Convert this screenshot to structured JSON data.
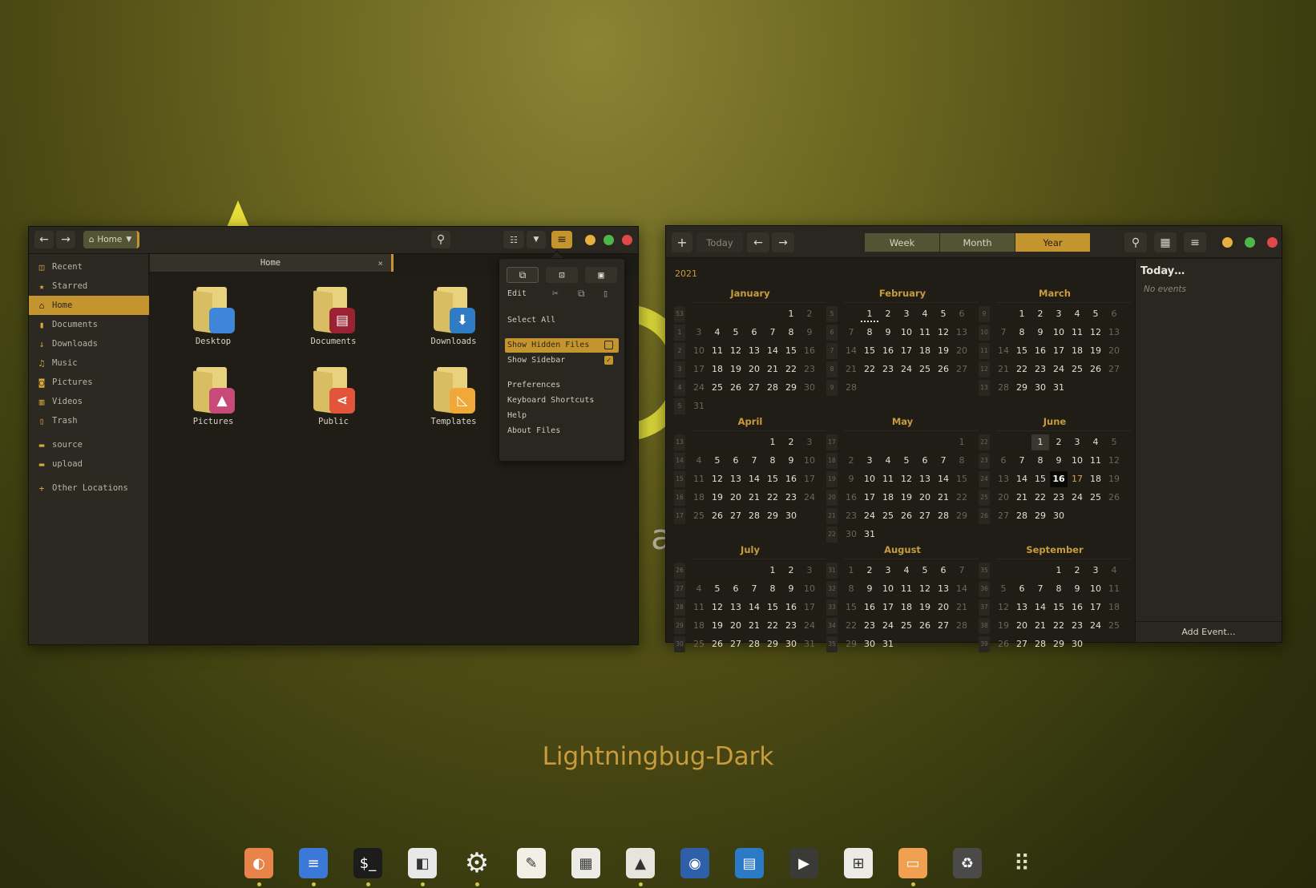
{
  "wallpaper": {
    "caption": "Lightningbug-Dark",
    "partial_letter": "a"
  },
  "files": {
    "path_button": "Home",
    "tab": {
      "label": "Home",
      "close": "×"
    },
    "sidebar": [
      {
        "label": "Recent",
        "icon": "recent-icon",
        "glyph": "◫"
      },
      {
        "label": "Starred",
        "icon": "star-icon",
        "glyph": "★"
      },
      {
        "label": "Home",
        "icon": "home-icon",
        "glyph": "⌂",
        "active": true
      },
      {
        "label": "Documents",
        "icon": "document-icon",
        "glyph": "▮"
      },
      {
        "label": "Downloads",
        "icon": "download-icon",
        "glyph": "↓"
      },
      {
        "label": "Music",
        "icon": "music-icon",
        "glyph": "♫"
      },
      {
        "label": "Pictures",
        "icon": "camera-icon",
        "glyph": "◙"
      },
      {
        "label": "Videos",
        "icon": "film-icon",
        "glyph": "▥"
      },
      {
        "label": "Trash",
        "icon": "trash-icon",
        "glyph": "▯"
      },
      {
        "label": "source",
        "icon": "folder-icon",
        "glyph": "▬"
      },
      {
        "label": "upload",
        "icon": "folder-icon",
        "glyph": "▬"
      },
      {
        "label": "Other Locations",
        "icon": "plus-icon",
        "glyph": "+"
      }
    ],
    "items": [
      {
        "label": "Desktop",
        "emblem": "desktop",
        "color": "#3f86d8",
        "glyph": ""
      },
      {
        "label": "Documents",
        "emblem": "document",
        "color": "#9b2232",
        "glyph": "▤"
      },
      {
        "label": "Downloads",
        "emblem": "download",
        "color": "#2f7bc4",
        "glyph": "⬇"
      },
      {
        "label": "Pictures",
        "emblem": "picture",
        "color": "#c84a78",
        "glyph": "▲"
      },
      {
        "label": "Public",
        "emblem": "share",
        "color": "#e2553a",
        "glyph": "⋖"
      },
      {
        "label": "Templates",
        "emblem": "template",
        "color": "#f0a938",
        "glyph": "◺"
      }
    ],
    "menu": {
      "edit_label": "Edit",
      "select_all": "Select All",
      "show_hidden": {
        "label": "Show Hidden Files",
        "checked": false
      },
      "show_sidebar": {
        "label": "Show Sidebar",
        "checked": true
      },
      "preferences": "Preferences",
      "shortcuts": "Keyboard Shortcuts",
      "help": "Help",
      "about": "About Files"
    }
  },
  "calendar": {
    "new_button": "+",
    "today_button": "Today",
    "views": [
      "Week",
      "Month",
      "Year"
    ],
    "active_view": "Year",
    "year": "2021",
    "today": {
      "month": 6,
      "day": 16
    },
    "highlight": {
      "month": 6,
      "day": 17
    },
    "selected": {
      "month": 6,
      "day": 1
    },
    "event_dot": {
      "month": 2,
      "day": 1
    },
    "months": [
      {
        "name": "January",
        "num": 1
      },
      {
        "name": "February",
        "num": 2
      },
      {
        "name": "March",
        "num": 3
      },
      {
        "name": "April",
        "num": 4
      },
      {
        "name": "May",
        "num": 5
      },
      {
        "name": "June",
        "num": 6
      },
      {
        "name": "July",
        "num": 7
      },
      {
        "name": "August",
        "num": 8
      },
      {
        "name": "September",
        "num": 9
      }
    ],
    "sidebar": {
      "title": "Today…",
      "empty": "No events",
      "add": "Add Event…"
    }
  },
  "dock": [
    {
      "name": "firefox",
      "running": true,
      "color": "#e8834a",
      "glyph": "◐"
    },
    {
      "name": "files-drawer",
      "running": true,
      "color": "#3b78d8",
      "glyph": "≡"
    },
    {
      "name": "terminal",
      "running": true,
      "color": "#1c1c1c",
      "glyph": "$_"
    },
    {
      "name": "tweaks",
      "running": true,
      "color": "#e8e8e8",
      "glyph": "◧"
    },
    {
      "name": "settings",
      "running": true,
      "color": "transparent",
      "glyph": "⚙"
    },
    {
      "name": "text-editor",
      "running": false,
      "color": "#f2f0e6",
      "glyph": "✎"
    },
    {
      "name": "calendar-app",
      "running": false,
      "color": "#ecebe6",
      "glyph": "▦"
    },
    {
      "name": "inkscape",
      "running": true,
      "color": "#e6e4dc",
      "glyph": "▲"
    },
    {
      "name": "screenshot",
      "running": false,
      "color": "#2f5fa8",
      "glyph": "◉"
    },
    {
      "name": "writer",
      "running": false,
      "color": "#2a7ac8",
      "glyph": "▤"
    },
    {
      "name": "video-player",
      "running": false,
      "color": "#3a3a36",
      "glyph": "▶"
    },
    {
      "name": "app-grid-software",
      "running": false,
      "color": "#eceae4",
      "glyph": "⊞"
    },
    {
      "name": "disks",
      "running": true,
      "color": "#f0a050",
      "glyph": "▭"
    },
    {
      "name": "trash-dock",
      "running": false,
      "color": "#4a4a48",
      "glyph": "♻"
    },
    {
      "name": "show-apps",
      "running": false,
      "color": "transparent",
      "glyph": "⠿"
    }
  ]
}
